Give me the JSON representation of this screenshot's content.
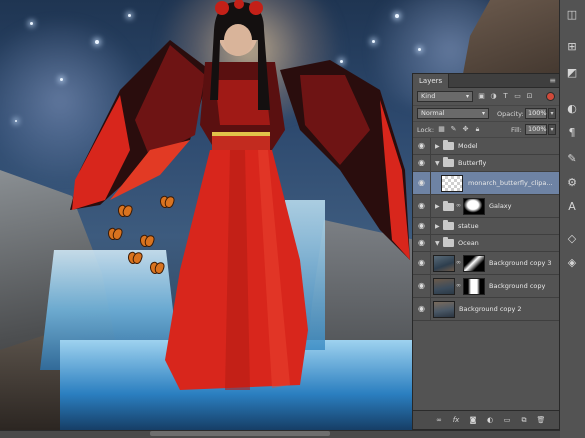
{
  "layers_panel": {
    "tab_label": "Layers",
    "filter_kind": "Kind",
    "blend_mode": "Normal",
    "opacity_label": "Opacity:",
    "opacity_value": "100%",
    "lock_label": "Lock:",
    "fill_label": "Fill:",
    "fill_value": "100%",
    "layers": [
      {
        "name": "Model",
        "kind": "group",
        "expanded": false,
        "selected": false
      },
      {
        "name": "Butterfly",
        "kind": "group",
        "expanded": true,
        "selected": false
      },
      {
        "name": "monarch_butterfly_clipa...",
        "kind": "layer",
        "selected": true
      },
      {
        "name": "Galaxy",
        "kind": "group",
        "expanded": false,
        "selected": false
      },
      {
        "name": "statue",
        "kind": "group",
        "expanded": false,
        "selected": false
      },
      {
        "name": "Ocean",
        "kind": "group",
        "expanded": true,
        "selected": false
      },
      {
        "name": "Background copy 3",
        "kind": "layer",
        "selected": false
      },
      {
        "name": "Background copy",
        "kind": "layer",
        "selected": false
      },
      {
        "name": "Background copy 2",
        "kind": "layer",
        "selected": false
      }
    ],
    "footer_icons": [
      "link-icon",
      "fx-icon",
      "mask-icon",
      "adjustment-icon",
      "new-group-icon",
      "new-layer-icon",
      "trash-icon"
    ]
  },
  "colors": {
    "panel_bg": "#535353",
    "selection": "#6e83a4",
    "dress_red": "#d8261c"
  }
}
